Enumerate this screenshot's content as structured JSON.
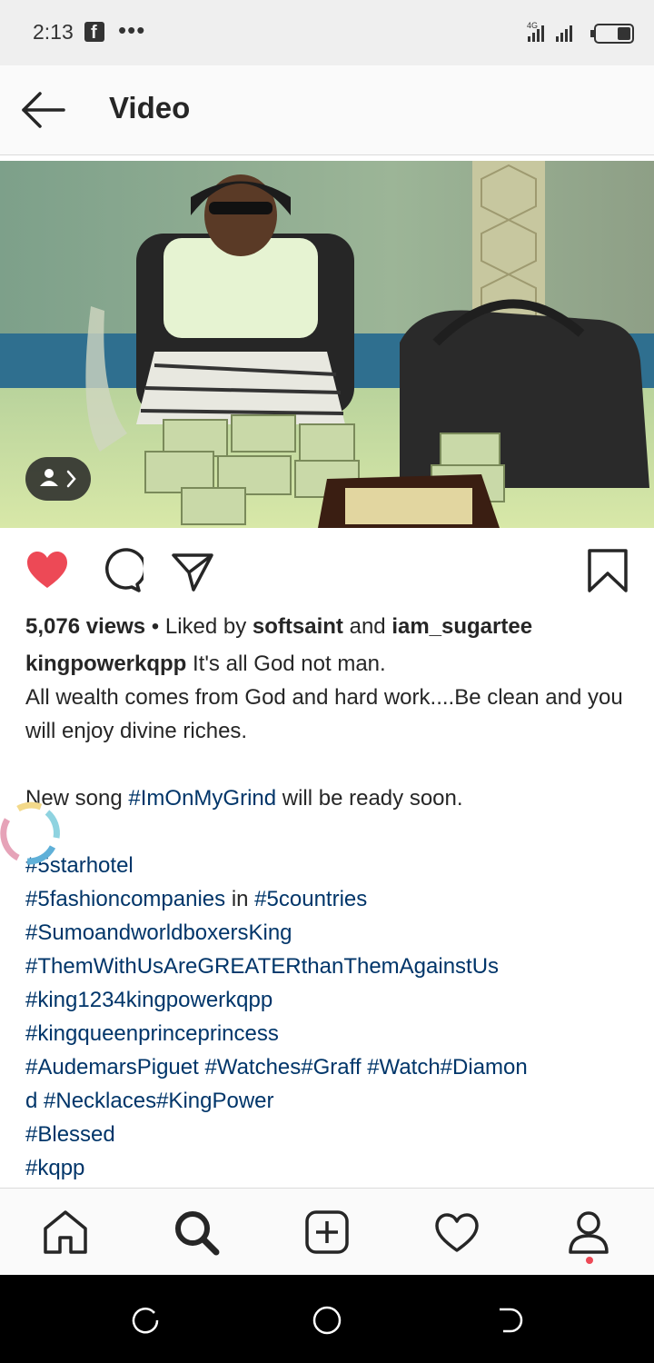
{
  "status_bar": {
    "time": "2:13",
    "facebook_icon": "f",
    "more_dots": "•••",
    "network": "4G"
  },
  "header": {
    "back_icon": "arrow-left",
    "title": "Video"
  },
  "post": {
    "views": "5,076 views",
    "liked_by_prefix": " • Liked by ",
    "liked_user_1": "softsaint",
    "liked_and": " and ",
    "liked_user_2": "iam_sugartee",
    "author": "kingpowerkqpp",
    "caption_line_1": " It's all God not man.",
    "caption_line_2": "All wealth comes from God and hard work....Be clean and you will enjoy divine riches.",
    "caption_line_3_prefix": "New song ",
    "caption_line_3_tag": "#ImOnMyGrind",
    "caption_line_3_suffix": " will be ready soon.",
    "tags": {
      "t1": "#5starhotel",
      "t2a": "#5fashioncompanies",
      "t2_mid": " in ",
      "t2b": "#5countries",
      "t3": "#SumoandworldboxersKing",
      "t4": "#ThemWithUsAreGREATERthanThemAgainstUs",
      "t5": "#king1234kingpowerkqpp",
      "t6": "#kingqueenprinceprincess",
      "t7a": "#AudemarsPiguet",
      "t7b": "#Watches#Graff",
      "t7c": "#Watch#Diamon",
      "t8a": "d",
      "t8b": "#Necklaces#KingPower",
      "t9": "#Blessed",
      "t10": "#kqpp"
    }
  },
  "colors": {
    "like_red": "#ed4956",
    "hashtag_blue": "#003569",
    "text": "#262626"
  },
  "icons": [
    "heart-filled-icon",
    "comment-icon",
    "share-icon",
    "bookmark-icon",
    "home-icon",
    "search-icon",
    "add-icon",
    "activity-heart-icon",
    "profile-icon"
  ]
}
